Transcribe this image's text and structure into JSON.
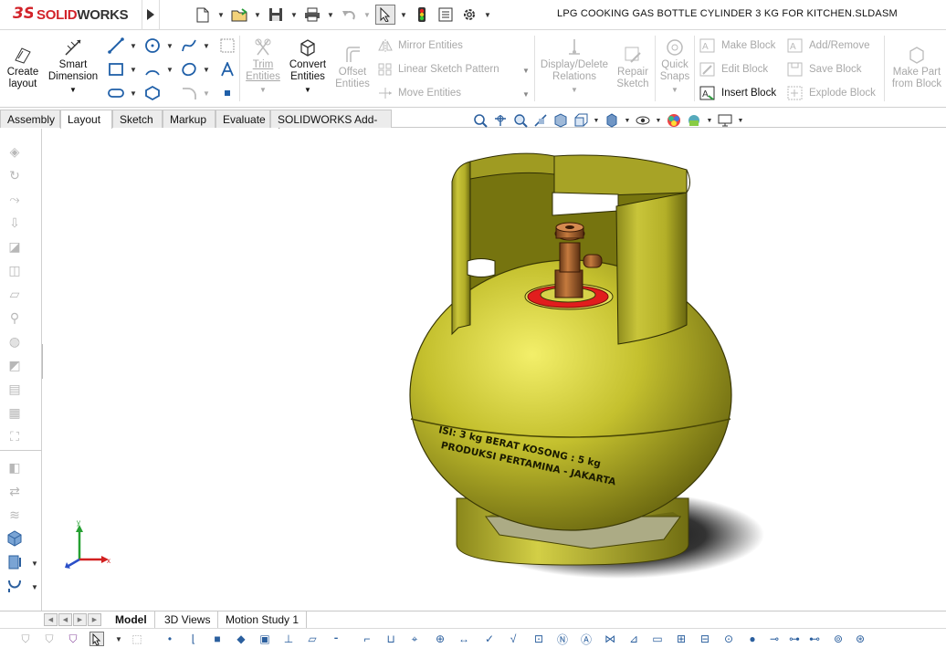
{
  "app": {
    "brand_ds": "3S",
    "brand_name_red": "SOLID",
    "brand_name_dark": "WORKS",
    "document_title": "LPG COOKING GAS BOTTLE CYLINDER  3 KG FOR KITCHEN.SLDASM"
  },
  "ribbon": {
    "create_layout": "Create\nlayout",
    "smart_dimension": "Smart\nDimension",
    "trim_entities": "Trim\nEntities",
    "convert_entities": "Convert\nEntities",
    "offset_entities": "Offset\nEntities",
    "mirror_entities": "Mirror Entities",
    "linear_sketch_pattern": "Linear Sketch Pattern",
    "move_entities": "Move Entities",
    "display_delete_relations": "Display/Delete\nRelations",
    "repair_sketch": "Repair\nSketch",
    "quick_snaps": "Quick\nSnaps",
    "make_block": "Make Block",
    "edit_block": "Edit Block",
    "insert_block": "Insert Block",
    "add_remove": "Add/Remove",
    "save_block": "Save Block",
    "explode_block": "Explode Block",
    "make_part_from_block": "Make Part\nfrom Block"
  },
  "tabs": [
    {
      "label": "Assembly",
      "active": false
    },
    {
      "label": "Layout",
      "active": true
    },
    {
      "label": "Sketch",
      "active": false
    },
    {
      "label": "Markup",
      "active": false
    },
    {
      "label": "Evaluate",
      "active": false
    },
    {
      "label": "SOLIDWORKS Add-Ins",
      "active": false
    }
  ],
  "model": {
    "label_line1": "ISI: 3 kg BERAT KOSONG : 5 kg",
    "label_line2": "PRODUKSI PERTAMINA - JAKARTA",
    "body_color": "#b9b52a",
    "ring_color": "#e11d1d",
    "valve_color": "#9b5a2a"
  },
  "triad": {
    "x": "x",
    "y": "y"
  },
  "bottom_tabs": [
    {
      "label": "Model",
      "active": true
    },
    {
      "label": "3D Views",
      "active": false
    },
    {
      "label": "Motion Study 1",
      "active": false
    }
  ],
  "colors": {
    "brand_red": "#d2232a",
    "accent_blue": "#2b5f9e",
    "disabled_gray": "#a8a8a8"
  }
}
